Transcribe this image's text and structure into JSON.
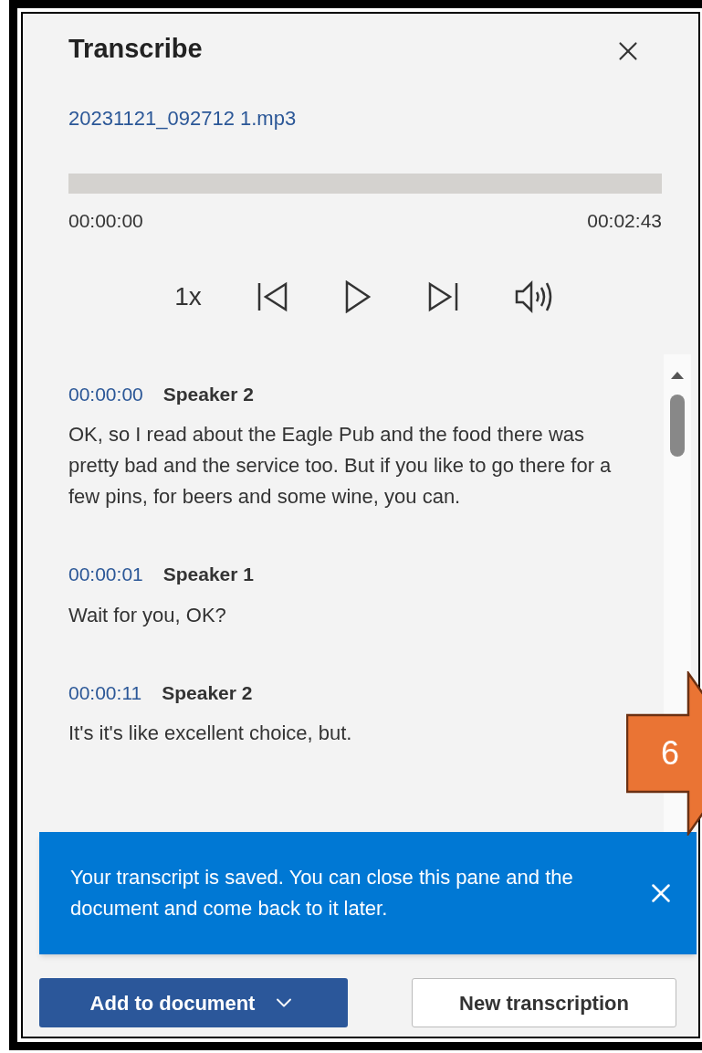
{
  "pane": {
    "title": "Transcribe",
    "file_name": "20231121_092712 1.mp3"
  },
  "player": {
    "elapsed": "00:00:00",
    "duration": "00:02:43",
    "speed": "1x"
  },
  "transcript": [
    {
      "time": "00:00:00",
      "speaker": "Speaker 2",
      "text": "OK, so I read about the Eagle Pub and the food there was pretty bad and the service too. But if you like to go there for a few pins, for beers and some wine, you can."
    },
    {
      "time": "00:00:01",
      "speaker": "Speaker 1",
      "text": "Wait for you, OK?"
    },
    {
      "time": "00:00:11",
      "speaker": "Speaker 2",
      "text": "It's it's like excellent choice, but."
    }
  ],
  "notification": {
    "text": "Your transcript is saved. You can close this pane and the document and come back to it later."
  },
  "buttons": {
    "primary": "Add to document",
    "secondary": "New transcription"
  },
  "callout": {
    "label": "6"
  }
}
